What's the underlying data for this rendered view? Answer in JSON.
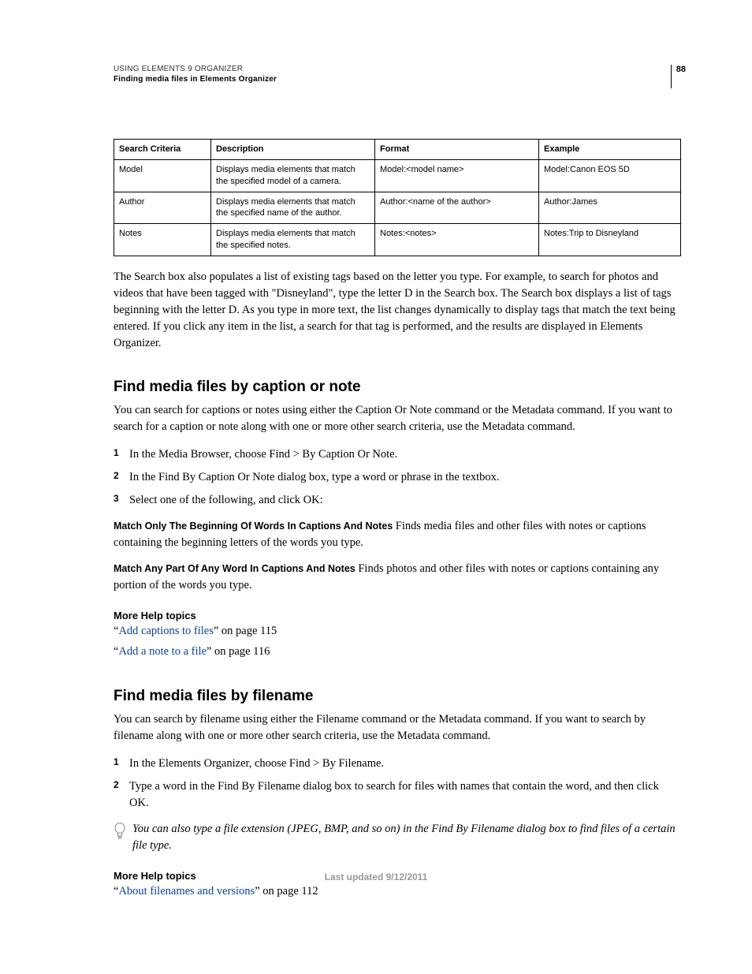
{
  "header": {
    "title": "USING ELEMENTS 9 ORGANIZER",
    "subtitle": "Finding media files in Elements Organizer",
    "page_number": "88"
  },
  "table": {
    "headers": [
      "Search Criteria",
      "Description",
      "Format",
      "Example"
    ],
    "rows": [
      [
        "Model",
        "Displays media elements that match the specified model of a camera.",
        "Model:<model name>",
        "Model:Canon EOS 5D"
      ],
      [
        "Author",
        "Displays media elements that match the specified name of the author.",
        "Author:<name of the author>",
        "Author:James"
      ],
      [
        "Notes",
        "Displays media elements that match the specified notes.",
        "Notes:<notes>",
        "Notes:Trip to Disneyland"
      ]
    ]
  },
  "para_searchbox": "The Search box also populates a list of existing tags based on the letter you type. For example, to search for photos and videos that have been tagged with \"Disneyland\", type the letter D in the Search box. The Search box displays a list of tags beginning with the letter D. As you type in more text, the list changes dynamically to display tags that match the text being entered. If you click any item in the list, a search for that tag is performed, and the results are displayed in Elements Organizer.",
  "section_caption": {
    "heading": "Find media files by caption or note",
    "intro": "You can search for captions or notes using either the Caption Or Note command or the Metadata command. If you want to search for a caption or note along with one or more other search criteria, use the Metadata command.",
    "steps": [
      "In the Media Browser, choose Find > By Caption Or Note.",
      "In the Find By Caption Or Note dialog box, type a word or phrase in the textbox.",
      "Select one of the following, and click OK:"
    ],
    "def1_term": "Match Only The Beginning Of Words In Captions And Notes",
    "def1_body": "  Finds media files and other files with notes or captions containing the beginning letters of the words you type.",
    "def2_term": "Match Any Part Of Any Word In Captions And Notes",
    "def2_body": "  Finds photos and other files with notes or captions containing any portion of the words you type.",
    "help_heading": "More Help topics",
    "help1_q1": "“",
    "help1_link": "Add captions to files",
    "help1_rest": "” on page 115",
    "help2_q1": "“",
    "help2_link": "Add a note to a file",
    "help2_rest": "” on page 116"
  },
  "section_filename": {
    "heading": "Find media files by filename",
    "intro": "You can search by filename using either the Filename command or the Metadata command. If you want to search by filename along with one or more other search criteria, use the Metadata command.",
    "steps": [
      "In the Elements Organizer, choose Find > By Filename.",
      "Type a word in the Find By Filename dialog box to search for files with names that contain the word, and then click OK."
    ],
    "tip": "You can also type a file extension (JPEG, BMP, and so on) in the Find By Filename dialog box to find files of a certain file type.",
    "help_heading": "More Help topics",
    "help1_q1": "“",
    "help1_link": "About filenames and versions",
    "help1_rest": "” on page 112"
  },
  "footer": "Last updated 9/12/2011"
}
